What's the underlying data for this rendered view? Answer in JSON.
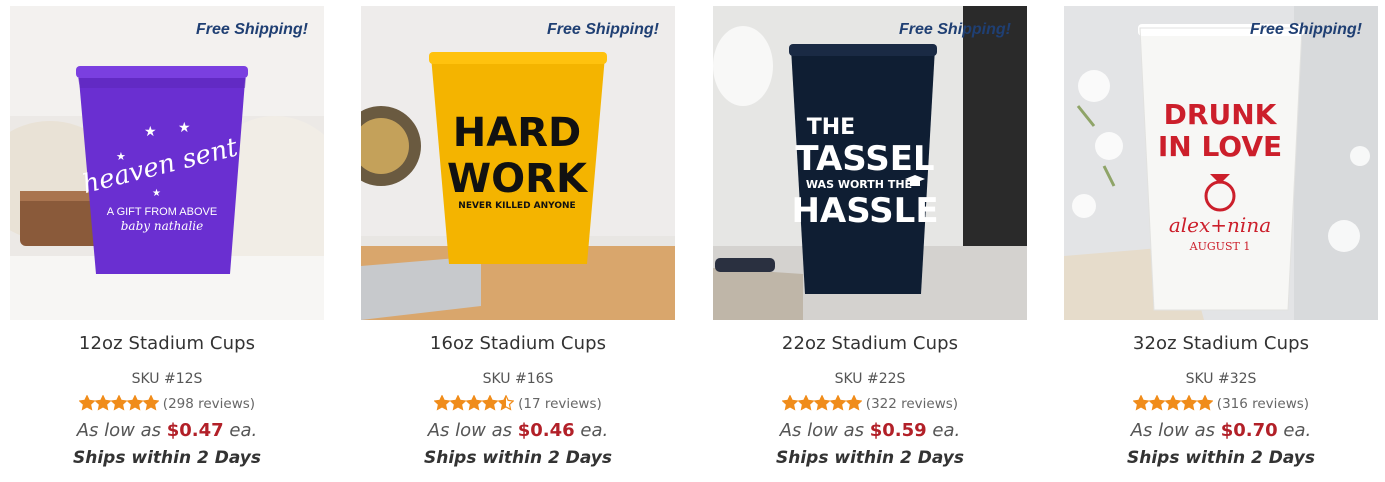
{
  "products": [
    {
      "badge": "Free Shipping!",
      "title": "12oz Stadium Cups",
      "sku": "SKU #12S",
      "rating": 5,
      "reviews": "(298 reviews)",
      "price_prefix": "As low as",
      "price": "$0.47",
      "price_suffix": "ea.",
      "ships": "Ships within 2 Days",
      "cup_color": "#6a2fd1",
      "cup_text": [
        "heaven sent",
        "A GIFT FROM ABOVE",
        "baby nathalie"
      ]
    },
    {
      "badge": "Free Shipping!",
      "title": "16oz Stadium Cups",
      "sku": "SKU #16S",
      "rating": 4.5,
      "reviews": "(17 reviews)",
      "price_prefix": "As low as",
      "price": "$0.46",
      "price_suffix": "ea.",
      "ships": "Ships within 2 Days",
      "cup_color": "#f4b400",
      "cup_text": [
        "HARD",
        "WORK",
        "NEVER KILLED ANYONE"
      ]
    },
    {
      "badge": "Free Shipping!",
      "title": "22oz Stadium Cups",
      "sku": "SKU #22S",
      "rating": 5,
      "reviews": "(322 reviews)",
      "price_prefix": "As low as",
      "price": "$0.59",
      "price_suffix": "ea.",
      "ships": "Ships within 2 Days",
      "cup_color": "#0f1e33",
      "cup_text": [
        "THE",
        "TASSEL",
        "WAS WORTH THE",
        "HASSLE"
      ]
    },
    {
      "badge": "Free Shipping!",
      "title": "32oz Stadium Cups",
      "sku": "SKU #32S",
      "rating": 5,
      "reviews": "(316 reviews)",
      "price_prefix": "As low as",
      "price": "$0.70",
      "price_suffix": "ea.",
      "ships": "Ships within 2 Days",
      "cup_color": "#f7f7f5",
      "cup_text": [
        "DRUNK",
        "IN LOVE",
        "alex+nina",
        "AUGUST 1"
      ]
    }
  ],
  "colors": {
    "badge": "#1f3f73",
    "price": "#b22028",
    "star": "#f08c1a"
  },
  "icons": [
    "star-icon",
    "half-star-icon",
    "diamond-ring-icon",
    "graduation-cap-icon"
  ]
}
